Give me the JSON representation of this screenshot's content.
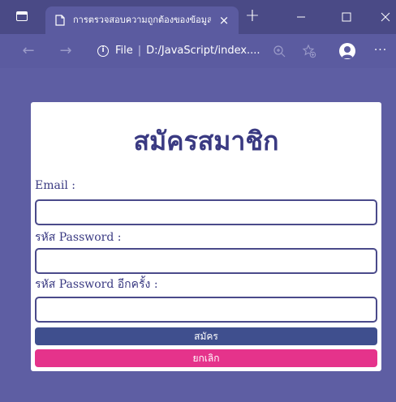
{
  "browser": {
    "tab_title": "การตรวจสอบความถูกต้องของข้อมูลใน",
    "tab_close_icon": "×",
    "new_tab_icon": "+",
    "address_label": "File",
    "address_url": "D:/JavaScript/index....",
    "more_icon": "···",
    "back_icon": "←",
    "forward_icon": "→",
    "info_icon": "i"
  },
  "form": {
    "title": "สมัครสมาชิก",
    "email_label": "Email :",
    "email_value": "",
    "password_label": "รหัส Password :",
    "password_value": "",
    "password_confirm_label": "รหัส Password อีกครั้ง :",
    "password_confirm_value": "",
    "submit_label": "สมัคร",
    "cancel_label": "ยกเลิก"
  },
  "colors": {
    "page_background": "#5e5ea3",
    "title_color": "#3a3a82",
    "submit_button": "#3f4f8e",
    "cancel_button": "#e5338b"
  }
}
